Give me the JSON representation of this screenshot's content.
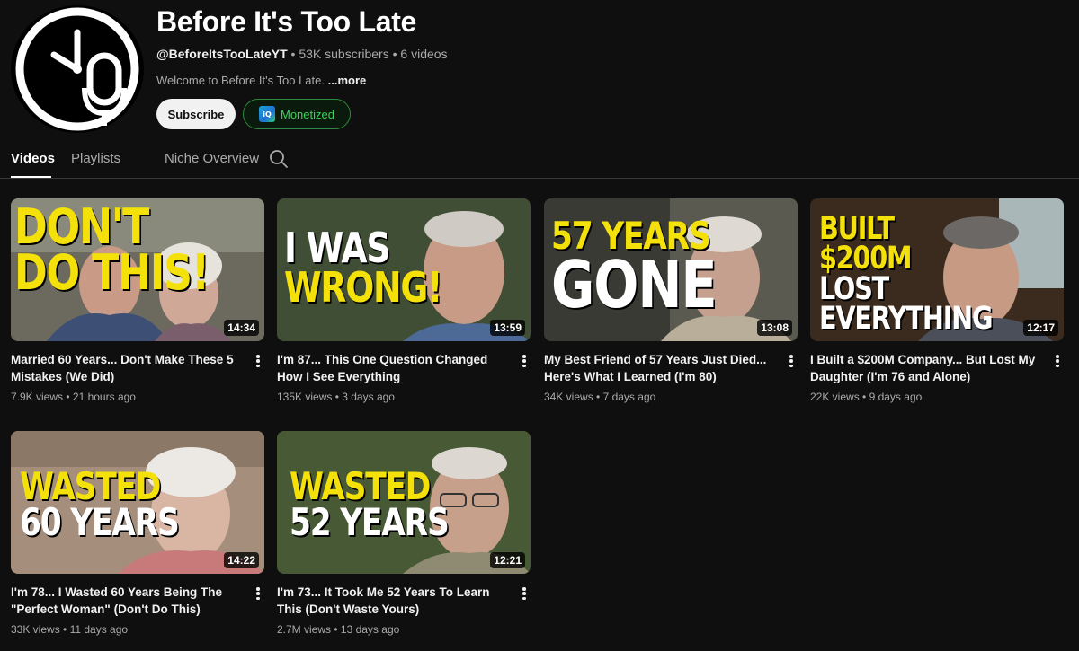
{
  "channel": {
    "name": "Before It's Too Late",
    "handle": "@BeforeItsTooLateYT",
    "subscribers": "53K subscribers",
    "videos_count": "6 videos",
    "description": "Welcome to Before It's Too Late.",
    "more_label": "...more",
    "subscribe_label": "Subscribe",
    "monetized_label": "Monetized"
  },
  "tabs": [
    {
      "label": "Videos",
      "active": true
    },
    {
      "label": "Playlists",
      "active": false
    },
    {
      "label": "Niche Overview",
      "active": false
    }
  ],
  "videos": [
    {
      "thumb_text": [
        "DON'T DO THIS!"
      ],
      "duration": "14:34",
      "title": "Married 60 Years... Don't Make These 5 Mistakes (We Did)",
      "views": "7.9K views",
      "age": "21 hours ago"
    },
    {
      "thumb_text": [
        "I WAS",
        "WRONG!"
      ],
      "duration": "13:59",
      "title": "I'm 87... This One Question Changed How I See Everything",
      "views": "135K views",
      "age": "3 days ago"
    },
    {
      "thumb_text": [
        "57 YEARS",
        "GONE"
      ],
      "duration": "13:08",
      "title": "My Best Friend of 57 Years Just Died... Here's What I Learned (I'm 80)",
      "views": "34K views",
      "age": "7 days ago"
    },
    {
      "thumb_text": [
        "BUILT",
        "$200M",
        "LOST",
        "EVERYTHING"
      ],
      "duration": "12:17",
      "title": "I Built a $200M Company... But Lost My Daughter (I'm 76 and Alone)",
      "views": "22K views",
      "age": "9 days ago"
    },
    {
      "thumb_text": [
        "WASTED",
        "60 YEARS"
      ],
      "duration": "14:22",
      "title": "I'm 78... I Wasted 60 Years Being The \"Perfect Woman\" (Don't Do This)",
      "views": "33K views",
      "age": "11 days ago"
    },
    {
      "thumb_text": [
        "WASTED",
        "52 YEARS"
      ],
      "duration": "12:21",
      "title": "I'm 73... It Took Me 52 Years To Learn This (Don't Waste Yours)",
      "views": "2.7M views",
      "age": "13 days ago"
    }
  ],
  "colors": {
    "background": "#0f0f0f",
    "thumb_yellow": "#f5e10a",
    "monetized_green": "#3dd15a"
  }
}
